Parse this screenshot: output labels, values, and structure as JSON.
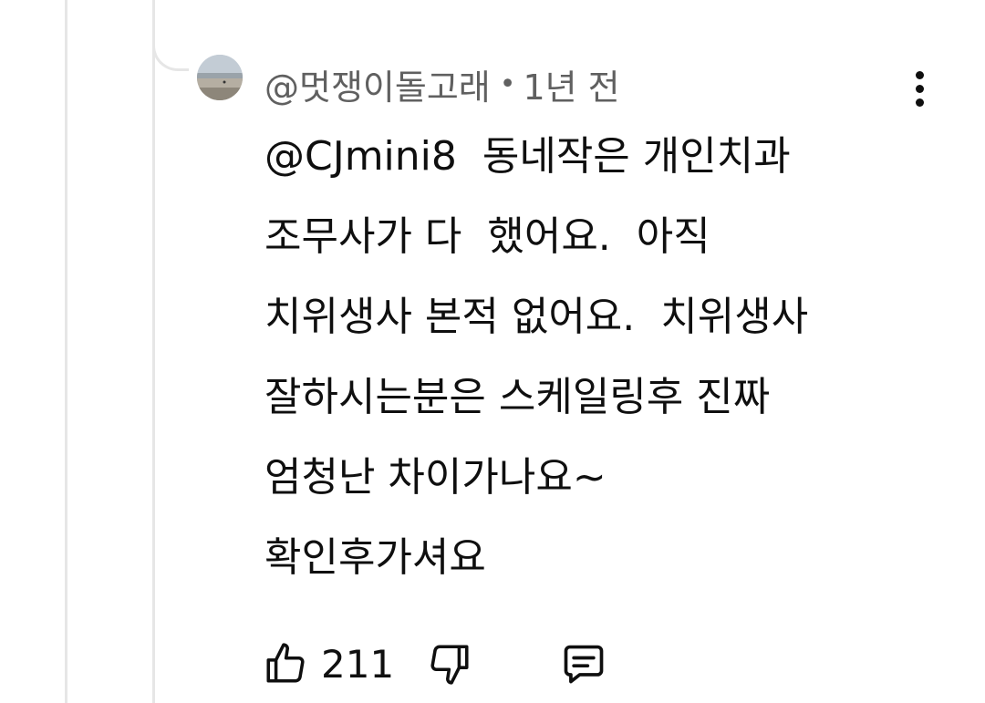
{
  "comment": {
    "author": "@멋쟁이돌고래",
    "separator": "•",
    "timestamp": "1년 전",
    "text_lines": [
      "@CJmini8  동네작은 개인치과",
      "조무사가 다  했어요.  아직",
      "치위생사 본적 없어요.  치위생사",
      "잘하시는분은 스케일링후 진짜",
      "엄청난 차이가나요~",
      "확인후가셔요"
    ],
    "like_count": "211"
  },
  "icons": {
    "avatar": "avatar-beach-photo",
    "more": "more-vertical-icon",
    "like": "thumbs-up-icon",
    "dislike": "thumbs-down-icon",
    "reply": "reply-comment-icon"
  }
}
